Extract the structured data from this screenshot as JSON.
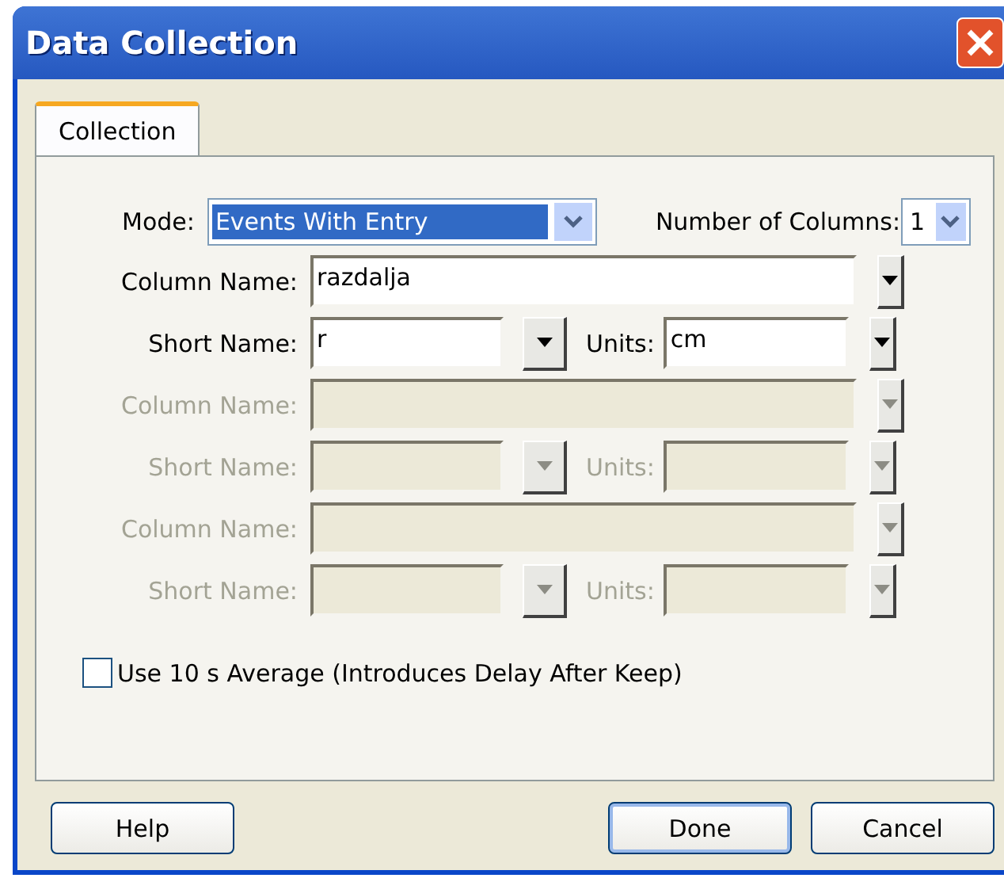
{
  "window": {
    "title": "Data Collection"
  },
  "tabs": [
    {
      "label": "Collection",
      "selected": true
    }
  ],
  "mode": {
    "label": "Mode:",
    "value": "Events With Entry"
  },
  "columns_count": {
    "label": "Number of Columns:",
    "value": "1"
  },
  "rows": [
    {
      "kind": "column",
      "label": "Column Name:",
      "value": "razdalja",
      "disabled": false
    },
    {
      "kind": "short",
      "label": "Short Name:",
      "value": "r",
      "units_label": "Units:",
      "units_value": "cm",
      "disabled": false
    },
    {
      "kind": "column",
      "label": "Column Name:",
      "disabled": true
    },
    {
      "kind": "short",
      "label": "Short Name:",
      "units_label": "Units:",
      "disabled": true
    },
    {
      "kind": "column",
      "label": "Column Name:",
      "disabled": true
    },
    {
      "kind": "short",
      "label": "Short Name:",
      "units_label": "Units:",
      "disabled": true
    }
  ],
  "average": {
    "label": "Use 10 s Average (Introduces Delay After Keep)",
    "checked": false
  },
  "buttons": [
    {
      "label": "Help",
      "kind": "left"
    },
    {
      "label": "Done",
      "kind": "default"
    },
    {
      "label": "Cancel",
      "kind": "normal"
    }
  ]
}
